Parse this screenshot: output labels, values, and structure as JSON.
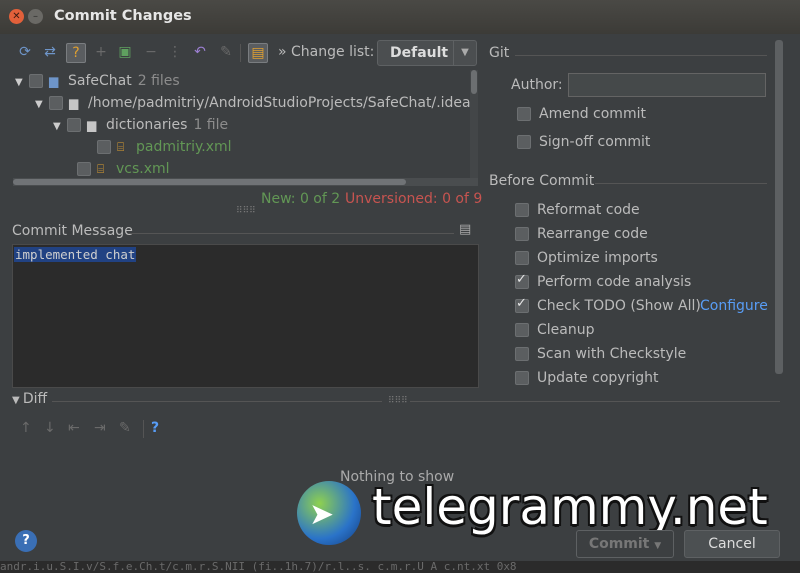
{
  "window": {
    "title": "Commit Changes"
  },
  "toolbar": {
    "icons": [
      "refresh-icon",
      "sync-icon",
      "question-icon",
      "add-icon",
      "commit-group-icon",
      "minus-icon",
      "move-icon",
      "undo-icon",
      "edit-icon",
      "changelist-icon"
    ],
    "changelist_label": "» Change list:",
    "changelist_value": "Default"
  },
  "tree": {
    "rows": [
      {
        "label": "SafeChat",
        "count": "2 files"
      },
      {
        "label": "/home/padmitriy/AndroidStudioProjects/SafeChat/.idea",
        "count": ""
      },
      {
        "label": "dictionaries",
        "count": "1 file"
      },
      {
        "label": "padmitriy.xml",
        "count": ""
      },
      {
        "label": "vcs.xml",
        "count": ""
      }
    ]
  },
  "status": {
    "new": "New: 0 of 2",
    "unversioned": "Unversioned: 0 of 9"
  },
  "commit_message": {
    "label": "Commit Message",
    "text": "implemented chat"
  },
  "git": {
    "title": "Git",
    "author_label": "Author:",
    "author_value": "",
    "amend": "Amend commit",
    "signoff": "Sign-off commit"
  },
  "before_commit": {
    "title": "Before Commit",
    "options": [
      {
        "label": "Reformat code",
        "checked": false
      },
      {
        "label": "Rearrange code",
        "checked": false
      },
      {
        "label": "Optimize imports",
        "checked": false
      },
      {
        "label": "Perform code analysis",
        "checked": true
      },
      {
        "label": "Check TODO (Show All)",
        "checked": true
      },
      {
        "label": "Cleanup",
        "checked": false
      },
      {
        "label": "Scan with Checkstyle",
        "checked": false
      },
      {
        "label": "Update copyright",
        "checked": false
      }
    ],
    "configure_link": "Configure"
  },
  "diff": {
    "label": "Diff",
    "empty_text": "Nothing to show"
  },
  "watermark": {
    "text": "telegrammy.net"
  },
  "buttons": {
    "help": "?",
    "commit": "Commit",
    "cancel": "Cancel"
  },
  "background_strip": "andr.i.u.S.I.v/S.f.e.Ch.t/c.m.r.S.NII (fi..1h.7)/r.l..s. c.m.r.U  A  c.nt.xt  0x8",
  "colors": {
    "bg": "#3c3f41",
    "accent_link": "#589df6",
    "new_green": "#629755",
    "unversioned_red": "#c75450",
    "selection": "#214283"
  }
}
